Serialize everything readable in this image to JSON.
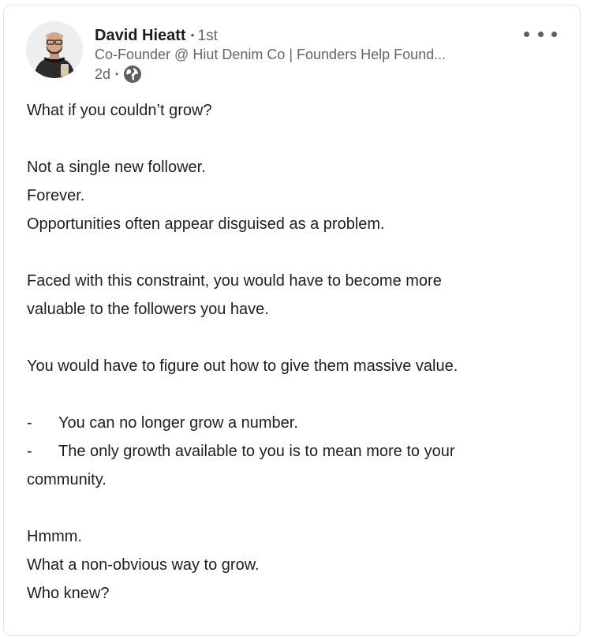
{
  "author": {
    "name": "David Hieatt",
    "separator": "•",
    "degree": "1st",
    "headline": "Co-Founder @ Hiut Denim Co | Founders Help Found...",
    "time": "2d",
    "time_separator": "•",
    "visibility_icon": "globe-icon"
  },
  "menu": {
    "icon": "more-horizontal-icon"
  },
  "post": {
    "line1": "What if you couldn’t grow?",
    "line2": "Not a single new follower.",
    "line3": "Forever.",
    "line4": "Opportunities often appear disguised as a problem.",
    "line5": "Faced with this constraint, you would have to become more",
    "line6": "valuable to the followers you have.",
    "line7": "You would have to figure out how to give them massive value.",
    "bullet_marker": "-",
    "bullet1": "You can no longer grow a number.",
    "bullet2": "The only growth available to you is to mean more to your",
    "bullet2_cont": "community.",
    "line8": "Hmmm.",
    "line9": "What a non-obvious way to grow.",
    "line10": "Who knew?"
  },
  "colors": {
    "card_border": "#e3e3e3",
    "text_primary": "#1f1f1f",
    "text_secondary": "#666666"
  }
}
